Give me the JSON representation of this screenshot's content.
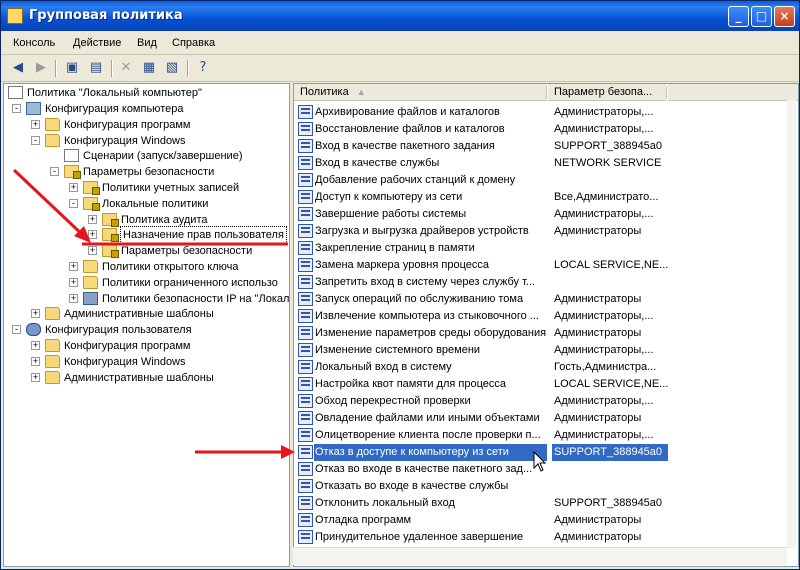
{
  "window": {
    "title": "Групповая политика"
  },
  "menu": [
    "Консоль",
    "Действие",
    "Вид",
    "Справка"
  ],
  "tree": {
    "root": "Политика \"Локальный компьютер\"",
    "items": [
      {
        "label": "Конфигурация компьютера",
        "depth": 0,
        "icon": "computer-icon",
        "exp": "-"
      },
      {
        "label": "Конфигурация программ",
        "depth": 1,
        "icon": "folder-icon",
        "exp": "+"
      },
      {
        "label": "Конфигурация Windows",
        "depth": 1,
        "icon": "folder-icon",
        "exp": "-"
      },
      {
        "label": "Сценарии (запуск/завершение)",
        "depth": 2,
        "icon": "document-icon",
        "exp": ""
      },
      {
        "label": "Параметры безопасности",
        "depth": 2,
        "icon": "lock-folder-icon",
        "exp": "-"
      },
      {
        "label": "Политики учетных записей",
        "depth": 3,
        "icon": "lock-folder-icon",
        "exp": "+"
      },
      {
        "label": "Локальные политики",
        "depth": 3,
        "icon": "lock-folder-icon",
        "exp": "-"
      },
      {
        "label": "Политика аудита",
        "depth": 4,
        "icon": "lock-folder-icon",
        "exp": "+"
      },
      {
        "label": "Назначение прав пользователя",
        "depth": 4,
        "icon": "lock-folder-icon",
        "exp": "+",
        "selected": true
      },
      {
        "label": "Параметры безопасности",
        "depth": 4,
        "icon": "lock-folder-icon",
        "exp": "+"
      },
      {
        "label": "Политики открытого ключа",
        "depth": 3,
        "icon": "folder-icon",
        "exp": "+"
      },
      {
        "label": "Политики ограниченного использо",
        "depth": 3,
        "icon": "folder-icon",
        "exp": "+"
      },
      {
        "label": "Политики безопасности IP на \"Локал",
        "depth": 3,
        "icon": "computer-small-icon",
        "exp": "+"
      },
      {
        "label": "Административные шаблоны",
        "depth": 1,
        "icon": "folder-icon",
        "exp": "+"
      },
      {
        "label": "Конфигурация пользователя",
        "depth": 0,
        "icon": "user-icon",
        "exp": "-"
      },
      {
        "label": "Конфигурация программ",
        "depth": 1,
        "icon": "folder-icon",
        "exp": "+"
      },
      {
        "label": "Конфигурация Windows",
        "depth": 1,
        "icon": "folder-icon",
        "exp": "+"
      },
      {
        "label": "Административные шаблоны",
        "depth": 1,
        "icon": "folder-icon",
        "exp": "+"
      }
    ]
  },
  "list": {
    "columns": [
      "Политика",
      "Параметр безопа..."
    ],
    "rows": [
      {
        "policy": "Архивирование файлов и каталогов",
        "setting": "Администраторы,..."
      },
      {
        "policy": "Восстановление файлов и каталогов",
        "setting": "Администраторы,..."
      },
      {
        "policy": "Вход в качестве пакетного задания",
        "setting": "SUPPORT_388945a0"
      },
      {
        "policy": "Вход в качестве службы",
        "setting": "NETWORK SERVICE"
      },
      {
        "policy": "Добавление рабочих станций к домену",
        "setting": ""
      },
      {
        "policy": "Доступ к компьютеру из сети",
        "setting": "Все,Администрато..."
      },
      {
        "policy": "Завершение работы системы",
        "setting": "Администраторы,..."
      },
      {
        "policy": "Загрузка и выгрузка драйверов устройств",
        "setting": "Администраторы"
      },
      {
        "policy": "Закрепление страниц в памяти",
        "setting": ""
      },
      {
        "policy": "Замена маркера уровня процесса",
        "setting": "LOCAL SERVICE,NE..."
      },
      {
        "policy": "Запретить вход в систему через службу т...",
        "setting": ""
      },
      {
        "policy": "Запуск операций по обслуживанию тома",
        "setting": "Администраторы"
      },
      {
        "policy": "Извлечение компьютера из стыковочного ...",
        "setting": "Администраторы,..."
      },
      {
        "policy": "Изменение параметров среды оборудования",
        "setting": "Администраторы"
      },
      {
        "policy": "Изменение системного времени",
        "setting": "Администраторы,..."
      },
      {
        "policy": "Локальный вход в систему",
        "setting": "Гость,Администра..."
      },
      {
        "policy": "Настройка квот памяти для процесса",
        "setting": "LOCAL SERVICE,NE..."
      },
      {
        "policy": "Обход перекрестной проверки",
        "setting": "Администраторы,..."
      },
      {
        "policy": "Овладение файлами или иными объектами",
        "setting": "Администраторы"
      },
      {
        "policy": "Олицетворение клиента после проверки п...",
        "setting": "Администраторы,..."
      },
      {
        "policy": "Отказ в доступе к компьютеру из сети",
        "setting": "SUPPORT_388945a0",
        "selected": true
      },
      {
        "policy": "Отказ во входе в качестве пакетного зад...",
        "setting": ""
      },
      {
        "policy": "Отказать во входе в качестве службы",
        "setting": ""
      },
      {
        "policy": "Отклонить локальный вход",
        "setting": "SUPPORT_388945a0"
      },
      {
        "policy": "Отладка программ",
        "setting": "Администраторы"
      },
      {
        "policy": "Принудительное удаленное завершение",
        "setting": "Администраторы"
      }
    ]
  }
}
